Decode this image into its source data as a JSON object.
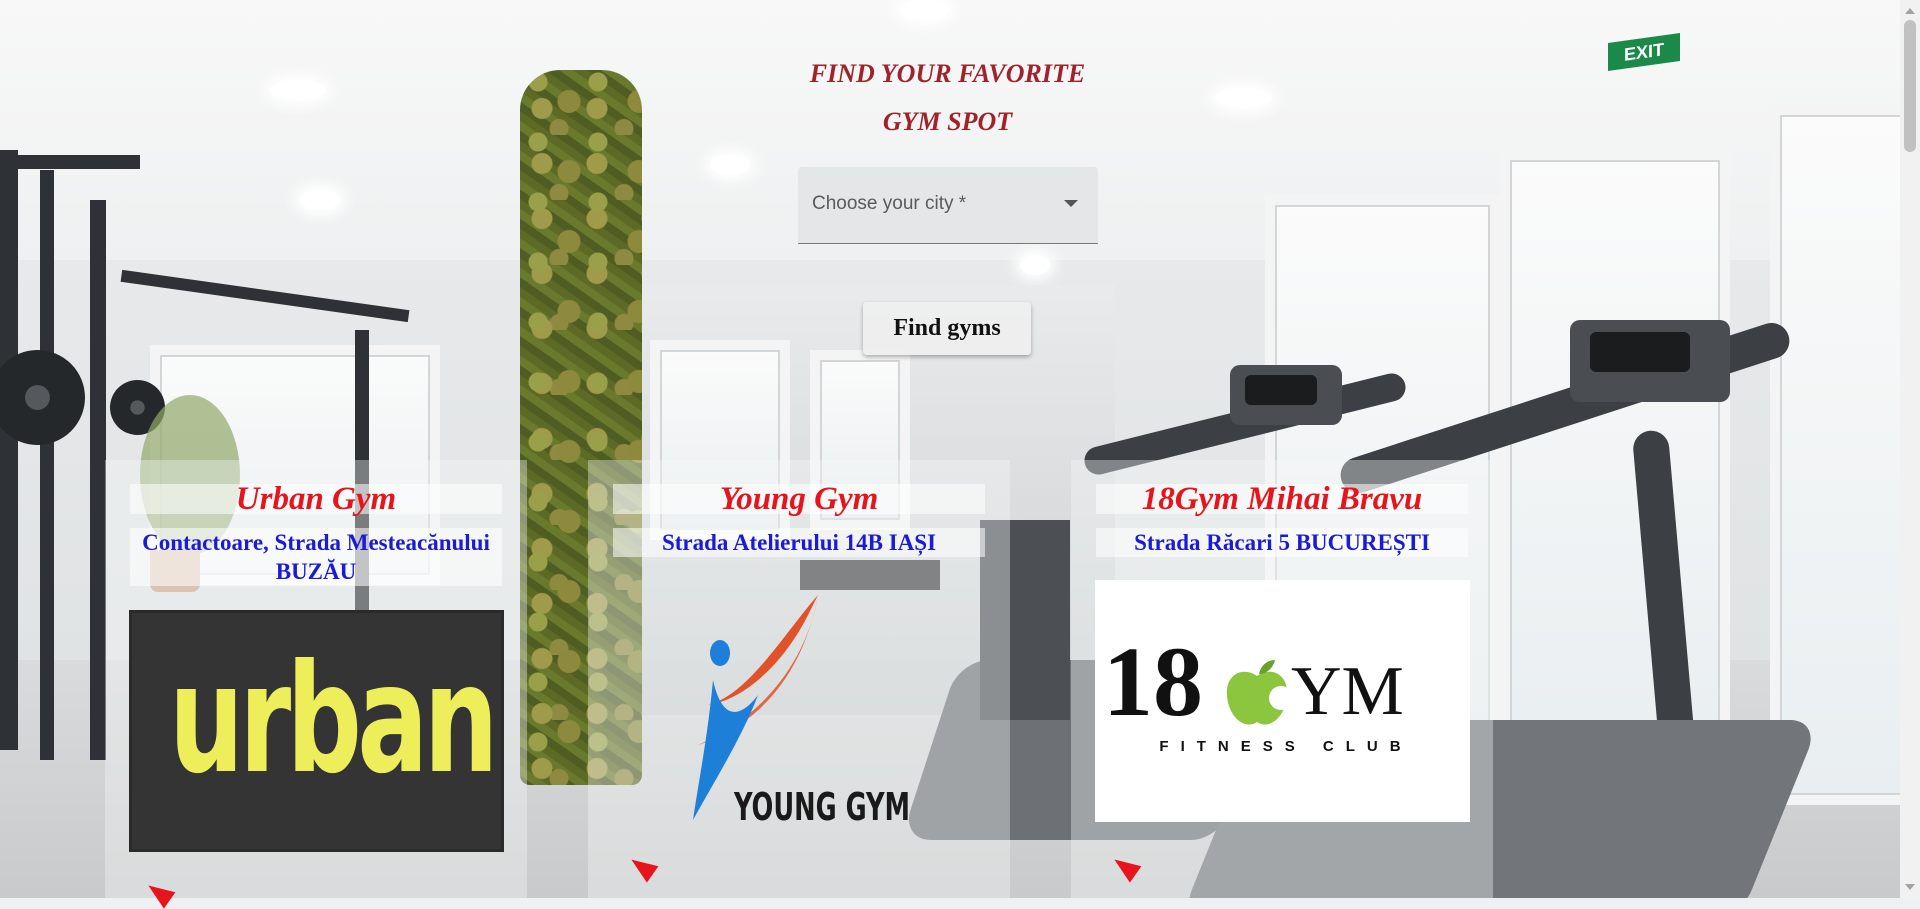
{
  "hero": {
    "title_line1": "FIND YOUR FAVORITE",
    "title_line2": "GYM SPOT"
  },
  "search": {
    "city_placeholder": "Choose your city *",
    "find_button": "Find gyms"
  },
  "gyms": [
    {
      "name": "Urban Gym",
      "address": "Contactoare, Strada Mesteacănului BUZĂU",
      "logo_text": "urban",
      "logo_colors": {
        "background": "#343434",
        "text": "#eeee5a"
      }
    },
    {
      "name": "Young Gym",
      "address": "Strada Atelierului 14B IAȘI",
      "logo_text": "YOUNG GYM",
      "logo_colors": {
        "swoosh": "#e0522a",
        "figure": "#1e7fd8",
        "text": "#1a1a1a"
      }
    },
    {
      "name": "18Gym Mihai Bravu",
      "address": "Strada Răcari 5 BUCUREȘTI",
      "logo_text_number": "18",
      "logo_text_word": "YM",
      "logo_tagline": "FITNESS CLUB",
      "logo_colors": {
        "background": "#ffffff",
        "apple": "#8cc63f",
        "text": "#111111"
      }
    }
  ],
  "colors": {
    "title": "#a0232b",
    "gym_name": "#e8141b",
    "address": "#1b1bd6"
  },
  "background": {
    "exit_sign": "EXIT"
  }
}
